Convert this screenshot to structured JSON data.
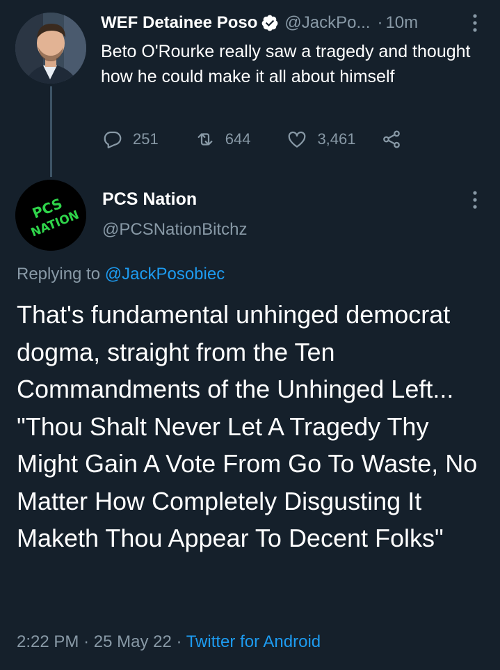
{
  "tweet1": {
    "display_name": "WEF Detainee Poso",
    "handle": "@JackPo...",
    "separator": "·",
    "time": "10m",
    "text": "Beto O'Rourke really saw a tragedy and thought how he could make it all about himself",
    "reply_count": "251",
    "retweet_count": "644",
    "like_count": "3,461",
    "icons": {
      "reply": "reply-icon",
      "retweet": "retweet-icon",
      "like": "heart-icon",
      "share": "share-icon",
      "verified": "verified-badge-icon",
      "more": "more-options-icon"
    }
  },
  "tweet2": {
    "display_name": "PCS Nation",
    "handle": "@PCSNationBitchz",
    "avatar_text_line1": "PCS",
    "avatar_text_line2": "NATION",
    "replying_prefix": "Replying to",
    "replying_mention": "@JackPosobiec",
    "text": "That's fundamental unhinged democrat dogma, straight from the Ten Commandments of the Unhinged Left...\n\"Thou Shalt Never Let A Tragedy Thy Might Gain A Vote From Go To Waste, No Matter How Completely Disgusting It Maketh Thou Appear To Decent Folks\"",
    "time": "2:22 PM",
    "date": "25 May 22",
    "separator": "·",
    "source": "Twitter for Android"
  },
  "colors": {
    "background": "#15202b",
    "secondary_text": "#8899a6",
    "link": "#1d9bf0",
    "avatar_text": "#2fd44a"
  }
}
